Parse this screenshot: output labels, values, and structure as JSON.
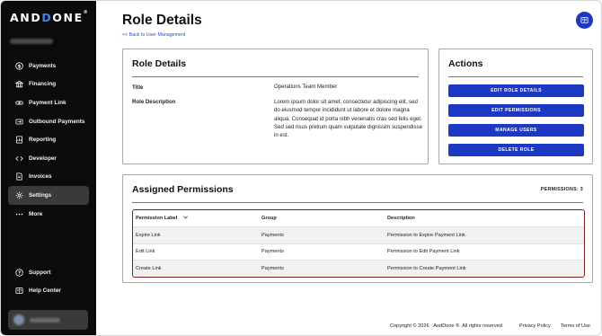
{
  "brand": {
    "logo_prefix": "AND",
    "logo_accent": "D",
    "logo_suffix": "ONE",
    "trademark": "®",
    "accent_color": "#3b82f6"
  },
  "sidebar": {
    "items": [
      {
        "label": "Payments",
        "icon": "dollar-circle-icon",
        "active": false
      },
      {
        "label": "Financing",
        "icon": "bank-icon",
        "active": false
      },
      {
        "label": "Payment Link",
        "icon": "link-icon",
        "active": false
      },
      {
        "label": "Outbound Payments",
        "icon": "outbound-icon",
        "active": false
      },
      {
        "label": "Reporting",
        "icon": "report-icon",
        "active": false
      },
      {
        "label": "Developer",
        "icon": "code-icon",
        "active": false
      },
      {
        "label": "Invoices",
        "icon": "invoice-icon",
        "active": false
      },
      {
        "label": "Settings",
        "icon": "gear-icon",
        "active": true
      },
      {
        "label": "More",
        "icon": "more-icon",
        "active": false
      }
    ],
    "bottom": [
      {
        "label": "Support",
        "icon": "question-icon"
      },
      {
        "label": "Help Center",
        "icon": "book-icon"
      }
    ]
  },
  "header": {
    "title": "Role Details",
    "back_link": "<< Back to User Management",
    "help_icon": "book-icon",
    "primary_color": "#1d39c4"
  },
  "role_card": {
    "title": "Role Details",
    "title_label": "Title",
    "title_value": "Operations Team Member",
    "description_label": "Role Description",
    "description_value": "Lorem ipsum dolor sit amet, consectetur adipiscing elit, sed do eiusmod tempor incididunt ut labore et dolore magna aliqua. Consequat id porta nibh venenatis cras sed felis eget. Sed sed risus pretium quam vulputate dignissim suspendisse in est."
  },
  "actions_card": {
    "title": "Actions",
    "buttons": [
      "EDIT ROLE DETAILS",
      "EDIT PERMISSIONS",
      "MANAGE USERS",
      "DELETE ROLE"
    ]
  },
  "permissions_card": {
    "title": "Assigned Permissions",
    "count_label": "PERMISSIONS: 3",
    "columns": [
      "Permission Label",
      "Group",
      "Description"
    ],
    "rows": [
      [
        "Expire Link",
        "Payments",
        "Permission to Expire Payment Link"
      ],
      [
        "Edit Link",
        "Payments",
        "Permission to Edit Payment Link"
      ],
      [
        "Create Link",
        "Payments",
        "Permission to Create Payment Link"
      ]
    ],
    "highlight_color": "#7a1e1e"
  },
  "footer": {
    "copyright": "Copyright © 2026 · AndDone ®. All rights reserved",
    "privacy": "Privacy Policy",
    "terms": "Terms of Use"
  }
}
